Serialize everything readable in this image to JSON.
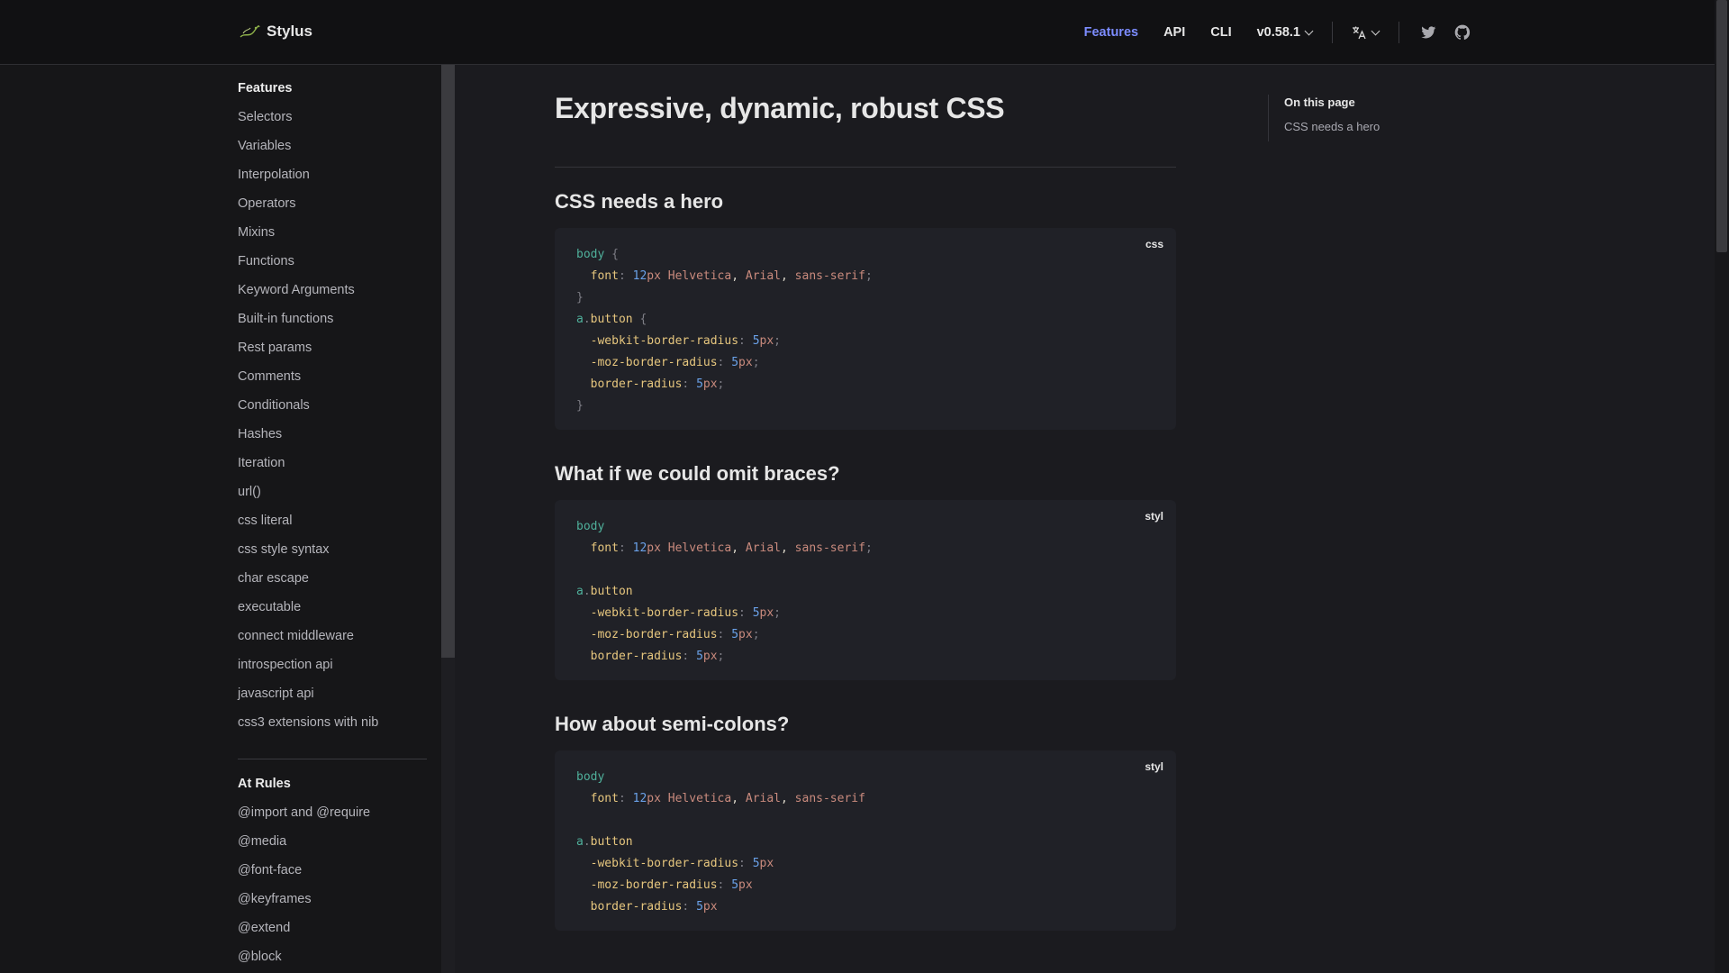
{
  "navbar": {
    "brand": "Stylus",
    "links": [
      {
        "label": "Features",
        "active": true
      },
      {
        "label": "API",
        "active": false
      },
      {
        "label": "CLI",
        "active": false
      }
    ],
    "version_label": "v0.58.1",
    "translate_icon": "translate-icon",
    "social_icons": [
      "twitter-icon",
      "github-icon"
    ],
    "accent_color": "#7c8cff"
  },
  "sidebar": {
    "groups": [
      {
        "title": "Features",
        "items": [
          "Selectors",
          "Variables",
          "Interpolation",
          "Operators",
          "Mixins",
          "Functions",
          "Keyword Arguments",
          "Built-in functions",
          "Rest params",
          "Comments",
          "Conditionals",
          "Hashes",
          "Iteration",
          "url()",
          "css literal",
          "css style syntax",
          "char escape",
          "executable",
          "connect middleware",
          "introspection api",
          "javascript api",
          "css3 extensions with nib"
        ]
      },
      {
        "title": "At Rules",
        "items": [
          "@import and @require",
          "@media",
          "@font-face",
          "@keyframes",
          "@extend",
          "@block"
        ]
      }
    ]
  },
  "main": {
    "title": "Expressive, dynamic, robust CSS",
    "sections": [
      {
        "heading": "CSS needs a hero",
        "lang": "css",
        "code": "body {\n  font: 12px Helvetica, Arial, sans-serif;\n}\na.button {\n  -webkit-border-radius: 5px;\n  -moz-border-radius: 5px;\n  border-radius: 5px;\n}"
      },
      {
        "heading": "What if we could omit braces?",
        "lang": "styl",
        "code": "body\n  font: 12px Helvetica, Arial, sans-serif;\n\na.button\n  -webkit-border-radius: 5px;\n  -moz-border-radius: 5px;\n  border-radius: 5px;"
      },
      {
        "heading": "How about semi-colons?",
        "lang": "styl",
        "code": "body\n  font: 12px Helvetica, Arial, sans-serif\n\na.button\n  -webkit-border-radius: 5px\n  -moz-border-radius: 5px\n  border-radius: 5px"
      }
    ]
  },
  "toc": {
    "title": "On this page",
    "items": [
      "CSS needs a hero"
    ]
  }
}
